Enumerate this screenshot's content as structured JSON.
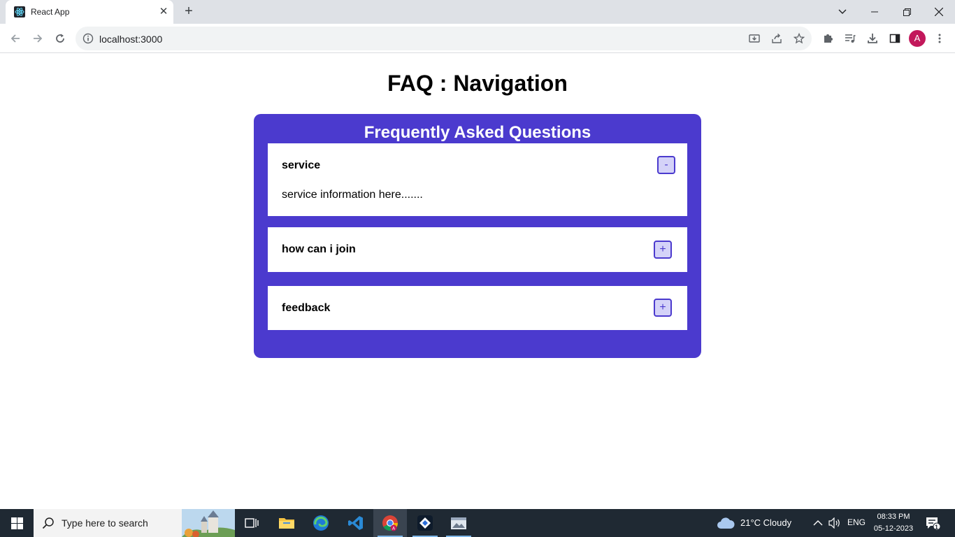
{
  "browser": {
    "tab_title": "React App",
    "url": "localhost:3000",
    "profile_initial": "A"
  },
  "page": {
    "title": "FAQ : Navigation",
    "faq_heading": "Frequently Asked Questions",
    "faqs": [
      {
        "question": "service",
        "answer": "service information here.......",
        "expanded": true,
        "toggle_label": "-"
      },
      {
        "question": "how can i join",
        "answer": "",
        "expanded": false,
        "toggle_label": "+"
      },
      {
        "question": "feedback",
        "answer": "",
        "expanded": false,
        "toggle_label": "+"
      }
    ]
  },
  "taskbar": {
    "search_placeholder": "Type here to search",
    "weather": "21°C  Cloudy",
    "language": "ENG",
    "time": "08:33 PM",
    "date": "05-12-2023",
    "notification_count": "1"
  },
  "colors": {
    "card_background": "#4b3ace",
    "toggle_background": "#d4d2f8",
    "tab_strip": "#dee1e6",
    "taskbar": "#1f2933"
  }
}
